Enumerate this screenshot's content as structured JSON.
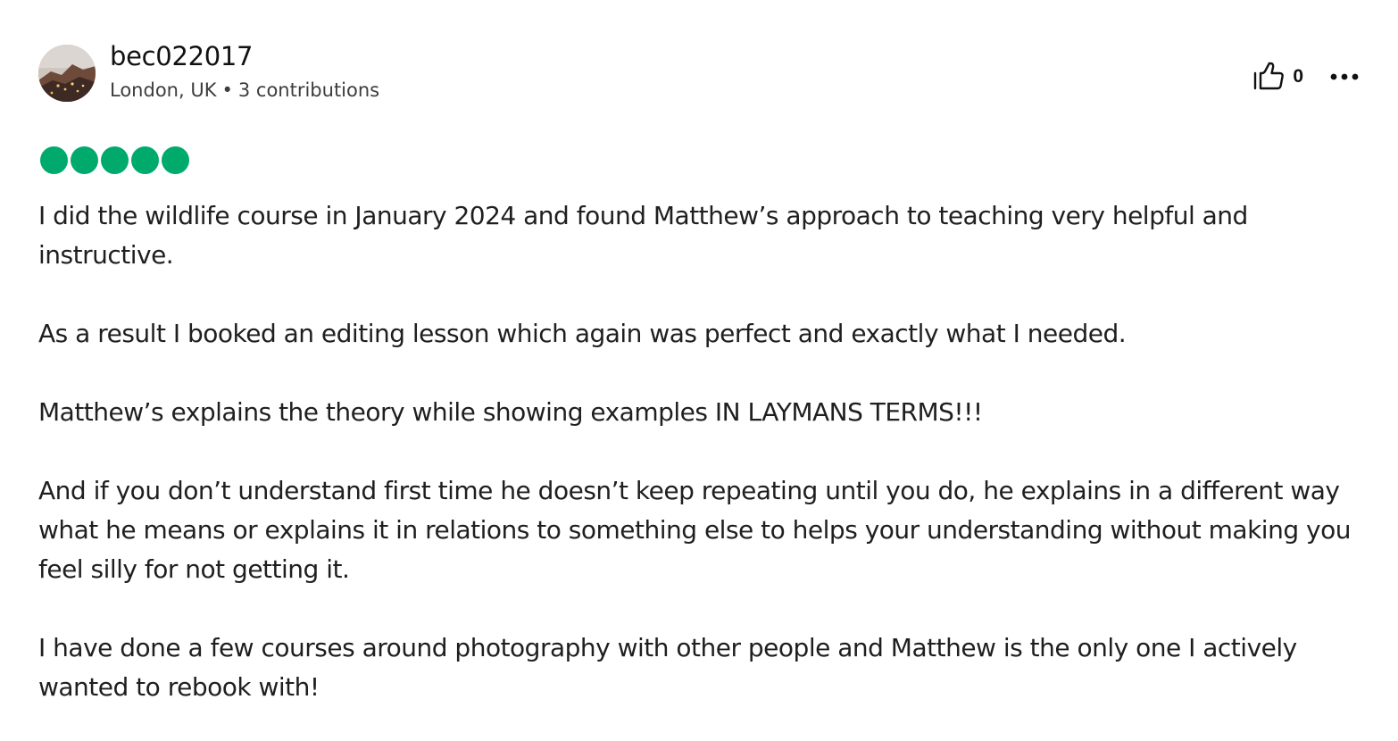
{
  "user": {
    "name": "bec022017",
    "location": "London, UK",
    "separator": "•",
    "contributions": "3 contributions"
  },
  "actions": {
    "helpful_icon": "thumbs-up-icon",
    "helpful_count": "0",
    "more_icon": "more-horizontal-icon"
  },
  "rating": {
    "value": 5,
    "max": 5,
    "color": "#00aa6c"
  },
  "review": {
    "paragraphs": [
      "I did the wildlife course in January 2024 and found Matthew’s approach to teaching very helpful and instructive.",
      "As a result I booked an editing lesson which again was perfect and exactly what I needed.",
      "Matthew’s explains the theory while showing examples IN LAYMANS TERMS!!!",
      "And if you don’t understand first time he doesn’t keep repeating until you do, he explains in a different way what he means or explains it in relations to something else to helps your understanding without making you feel silly for not getting it.",
      "I have done a few courses around photography with other people and Matthew is the only one I actively wanted to rebook with!"
    ]
  }
}
